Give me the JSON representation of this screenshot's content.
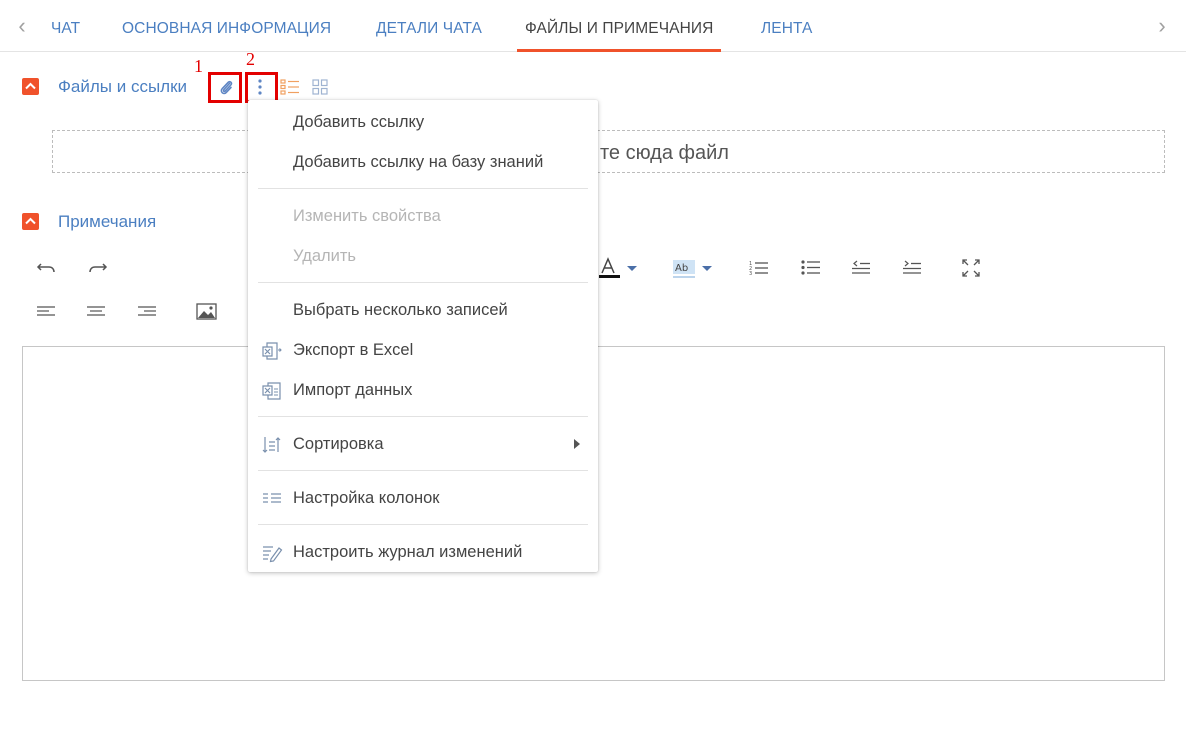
{
  "tabs": [
    {
      "label": "ЧАТ",
      "active": false
    },
    {
      "label": "ОСНОВНАЯ ИНФОРМАЦИЯ",
      "active": false
    },
    {
      "label": "ДЕТАЛИ ЧАТА",
      "active": false
    },
    {
      "label": "ФАЙЛЫ И ПРИМЕЧАНИЯ",
      "active": true
    },
    {
      "label": "ЛЕНТА",
      "active": false
    }
  ],
  "files_section": {
    "title": "Файлы и ссылки",
    "drop_text": "те сюда файл",
    "callout_1": "1",
    "callout_2": "2"
  },
  "notes_section": {
    "title": "Примечания"
  },
  "menu": {
    "items": [
      {
        "label": "Добавить ссылку",
        "disabled": false,
        "icon": "none"
      },
      {
        "label": "Добавить ссылку на базу знаний",
        "disabled": false,
        "icon": "none"
      },
      {
        "label": "Изменить свойства",
        "disabled": true,
        "icon": "none"
      },
      {
        "label": "Удалить",
        "disabled": true,
        "icon": "none"
      },
      {
        "label": "Выбрать несколько записей",
        "disabled": false,
        "icon": "none"
      },
      {
        "label": "Экспорт в Excel",
        "disabled": false,
        "icon": "excel-export-icon"
      },
      {
        "label": "Импорт данных",
        "disabled": false,
        "icon": "excel-import-icon"
      },
      {
        "label": "Сортировка",
        "disabled": false,
        "icon": "sort-icon",
        "submenu": true
      },
      {
        "label": "Настройка колонок",
        "disabled": false,
        "icon": "columns-icon"
      },
      {
        "label": "Настроить журнал изменений",
        "disabled": false,
        "icon": "change-log-icon"
      }
    ]
  },
  "colors": {
    "accent": "#f0522b",
    "link": "#4b7fc1",
    "highlight": "#e30000",
    "icon": "#7a90ad"
  }
}
